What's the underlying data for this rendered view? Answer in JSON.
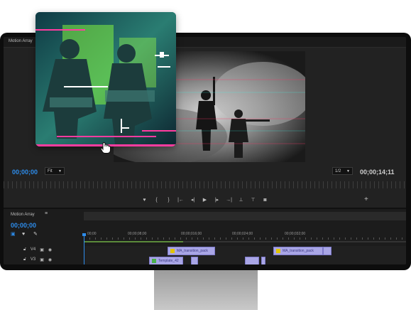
{
  "program": {
    "panel_title": "Motion Array",
    "timecode_current": "00;00;00",
    "fit_label": "Fit",
    "zoom_label": "1/2",
    "timecode_duration": "00;00;14;11"
  },
  "timeline": {
    "panel_title": "Motion Array",
    "timecode": "00;00;00",
    "ruler_labels": [
      "00;00",
      "00;00;08;00",
      "00;00;016;00",
      "00;00;024;00",
      "00;00;032;00"
    ],
    "tracks": [
      {
        "name": "V4"
      },
      {
        "name": "V3"
      }
    ],
    "clips": {
      "v4_clip1": "MA_transition_pack",
      "v4_clip2": "MA_transition_pack",
      "v3_clip1": "Template_42"
    }
  },
  "icons": [
    "marker-icon",
    "in-point-icon",
    "out-point-icon",
    "go-to-in-icon",
    "step-back-icon",
    "play-icon",
    "step-forward-icon",
    "go-to-out-icon",
    "lift-icon",
    "extract-icon",
    "camera-icon",
    "add-icon",
    "lock-icon",
    "toggle-output-icon",
    "eye-icon",
    "hand-cursor-icon"
  ],
  "colors": {
    "accent": "#2d8ceb",
    "clip": "#a9a6e6",
    "overlay_green": "#78ff3c",
    "overlay_pink": "#ff3ca0"
  }
}
